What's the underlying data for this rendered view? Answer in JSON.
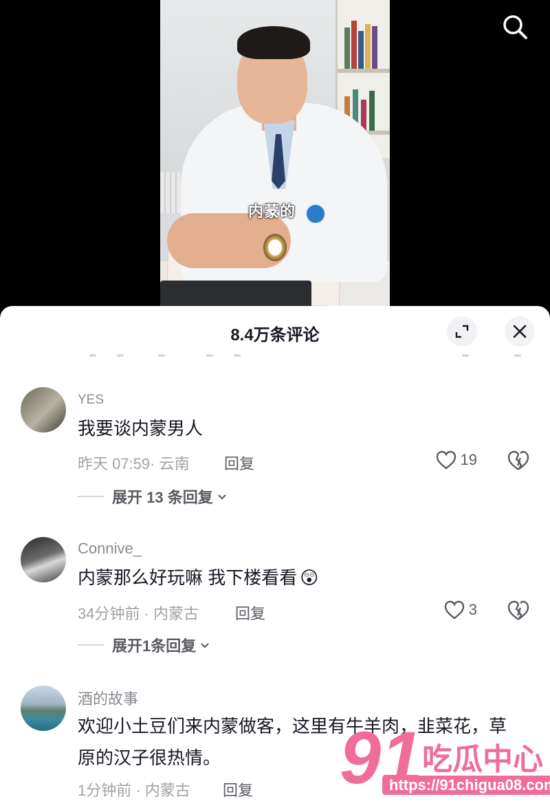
{
  "video": {
    "caption": "内蒙的"
  },
  "sheet": {
    "title": "8.4万条评论"
  },
  "comments": [
    {
      "username": "YES",
      "text": "我要谈内蒙男人",
      "meta": "昨天 07:59· 云南",
      "reply_label": "回复",
      "likes": "19",
      "expand_label": "展开 13 条回复"
    },
    {
      "username": "Connive_",
      "text": "内蒙那么好玩嘛 我下楼看看",
      "emoji": "😲",
      "meta": "34分钟前 · 内蒙古",
      "reply_label": "回复",
      "likes": "3",
      "expand_label": "展开1条回复"
    },
    {
      "username": "酒的故事",
      "text": "欢迎小土豆们来内蒙做客，这里有牛羊肉，韭菜花，草原的汉子很热情。",
      "meta": "1分钟前 · 内蒙古",
      "reply_label": "回复"
    }
  ],
  "watermark": {
    "number": "91",
    "name": "吃瓜中心",
    "url": "https://91chigua08.com"
  },
  "colors": {
    "sheet_bg": "#ffffff",
    "text_primary": "#161823",
    "text_secondary": "#a0a1a7",
    "watermark": "#f06d9b"
  },
  "icons": [
    "search-icon",
    "expand-icon",
    "close-icon",
    "heart-icon",
    "broken-heart-icon",
    "chevron-down-icon"
  ]
}
